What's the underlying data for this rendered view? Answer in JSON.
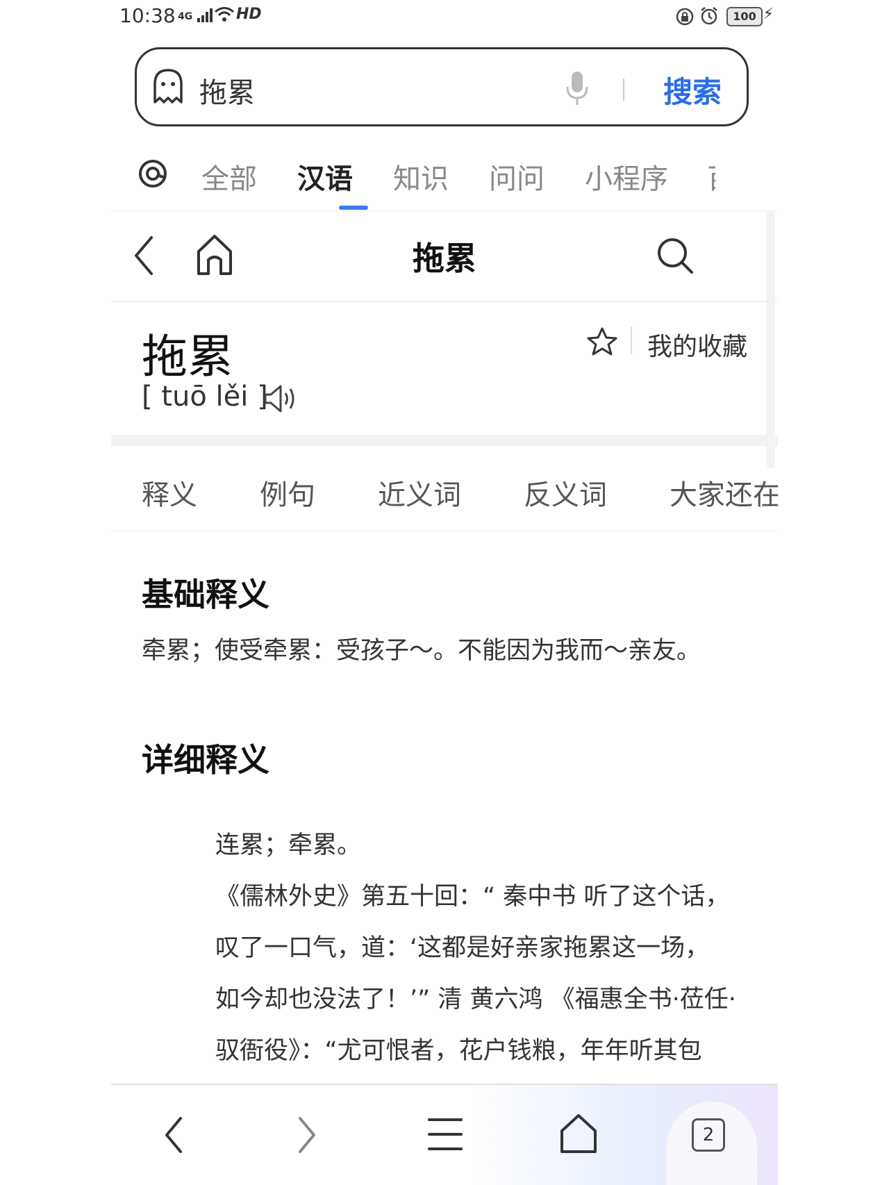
{
  "status_bar": {
    "time": "10:38",
    "network": "4G",
    "hd": "HD",
    "battery": "100"
  },
  "search": {
    "query": "拖累",
    "button": "搜索"
  },
  "category_tabs": [
    "全部",
    "汉语",
    "知识",
    "问问",
    "小程序",
    "百"
  ],
  "header": {
    "title": "拖累"
  },
  "entry": {
    "word": "拖累",
    "pinyin": "[ tuō lěi ]",
    "favorites_label": "我的收藏"
  },
  "section_tabs": [
    "释义",
    "例句",
    "近义词",
    "反义词",
    "大家还在"
  ],
  "basic": {
    "heading": "基础释义",
    "text": "牵累；使受牵累：受孩子～。不能因为我而～亲友。"
  },
  "detail": {
    "heading": "详细释义",
    "lines": [
      "连累；牵累。",
      "《儒林外史》第五十回：“ 秦中书 听了这个话，",
      "叹了一口气，道：‘这都是好亲家拖累这一场，",
      "如今却也没法了！’” 清 黄六鸿 《福惠全书·莅任·",
      "驭衙役》：“尤可恨者，花户钱粮，年年听其包"
    ]
  },
  "bottom_nav": {
    "tab_count": "2"
  },
  "colors": {
    "accent": "#2b6de8",
    "tab_indicator": "#3a7cf0"
  }
}
